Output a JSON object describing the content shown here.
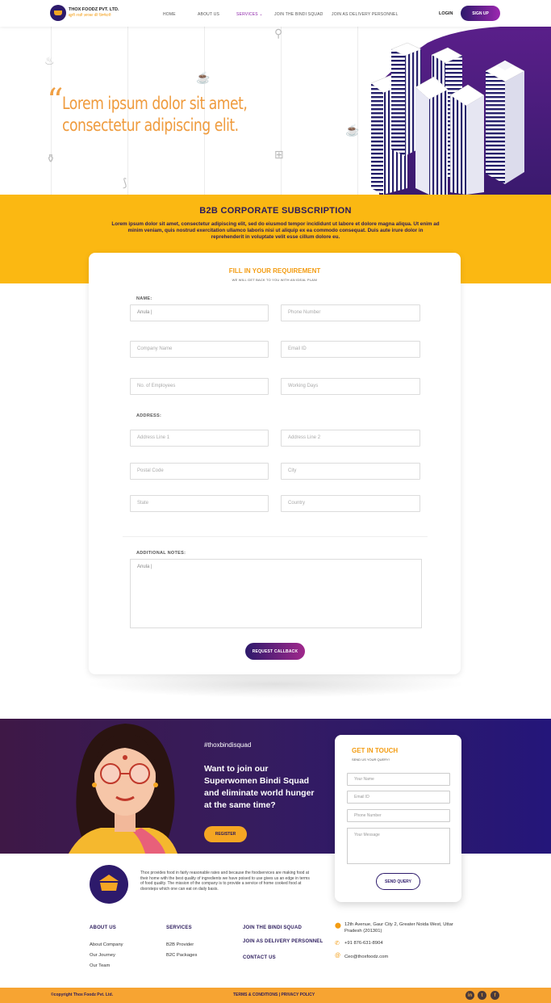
{
  "header": {
    "logo_name": "THOX FOODZ PVT. LTD.",
    "logo_tag": "ख़ुशी ताज़ी ज़ायका की ज़िम्मेदारी",
    "nav": [
      "HOME",
      "ABOUT US",
      "SERVICES",
      "JOIN THE BINDI SQUAD",
      "JOIN AS DELIVERY PERSONNEL"
    ],
    "login": "LOGIN",
    "signup": "SIGN UP"
  },
  "hero": {
    "quote": "“",
    "text": "Lorem ipsum dolor sit amet, consectetur adipiscing elit."
  },
  "b2b": {
    "title": "B2B CORPORATE SUBSCRIPTION",
    "description": "Lorem ipsum dolor sit amet, consectetur adipiscing elit, sed do eiusmod tempor incididunt ut labore et dolore magna aliqua. Ut enim ad minim veniam, quis nostrud exercitation ullamco laboris nisi ut aliquip ex ea commodo consequat. Duis aute irure dolor in reprehenderit in voluptate velit esse cillum dolore eu."
  },
  "form": {
    "title": "FILL IN YOUR REQUIREMENT",
    "subtitle": "WE WILL GET BACK TO YOU WITH AN IDEAL PLAN!",
    "name_label": "NAME:",
    "name_value": "Anula |",
    "phone": "Phone Number",
    "company": "Company Name",
    "email": "Email ID",
    "employees": "No. of Employees",
    "working_days": "Working Days",
    "address_label": "ADDRESS:",
    "address1": "Address Line 1",
    "address2": "Address Line 2",
    "postal": "Postal Code",
    "city": "City",
    "state": "State",
    "country": "Country",
    "notes_label": "ADDITIONAL NOTES:",
    "notes_value": "Anula |",
    "submit": "REQUEST CALLBACK"
  },
  "bindi": {
    "hashtag": "#thoxbindisquad",
    "text": "Want to join our Superwomen Bindi Squad and eliminate world hunger at the same time?",
    "register": "REGISTER"
  },
  "touch": {
    "title": "GET IN TOUCH",
    "subtitle": "SEND US YOUR QUERY!",
    "name": "Your Name",
    "email": "Email ID",
    "phone": "Phone Number",
    "message": "Your Message",
    "send": "SEND QUERY"
  },
  "footer": {
    "about_text": "Thox provides food in fairly reasonable rates and because the foodservices are making food at their home with the best quality of ingredients we have poised to use gives us an edge in terms of food quality. The mission of the company is to provide a service of home cooked food at doorsteps which one can eat on daily basis.",
    "col1_head": "ABOUT US",
    "col1_links": [
      "About Company",
      "Our Journey",
      "Our Team"
    ],
    "col2_head": "SERVICES",
    "col2_links": [
      "B2B Provider",
      "B2C Packages"
    ],
    "col3_links": [
      "JOIN THE BINDI SQUAD",
      "JOIN AS DELIVERY PERSONNEL",
      "CONTACT US"
    ],
    "address": "12th Avenue, Gaur City 2, Greater Noida West, Uttar Pradesh (201301)",
    "phone": "+91 876-631-8904",
    "email": "Ceo@thoxfoodz.com",
    "copyright": "©copyright Thox Foodz Pvt. Ltd.",
    "terms": "TERMS & CONDITIONS  |  PRIVACY POLICY",
    "social": [
      "in",
      "t",
      "f"
    ]
  },
  "colors": {
    "orange": "#f39c12",
    "yellow": "#fbb812",
    "navy": "#2b1b5c",
    "purple": "#9c27b0"
  }
}
